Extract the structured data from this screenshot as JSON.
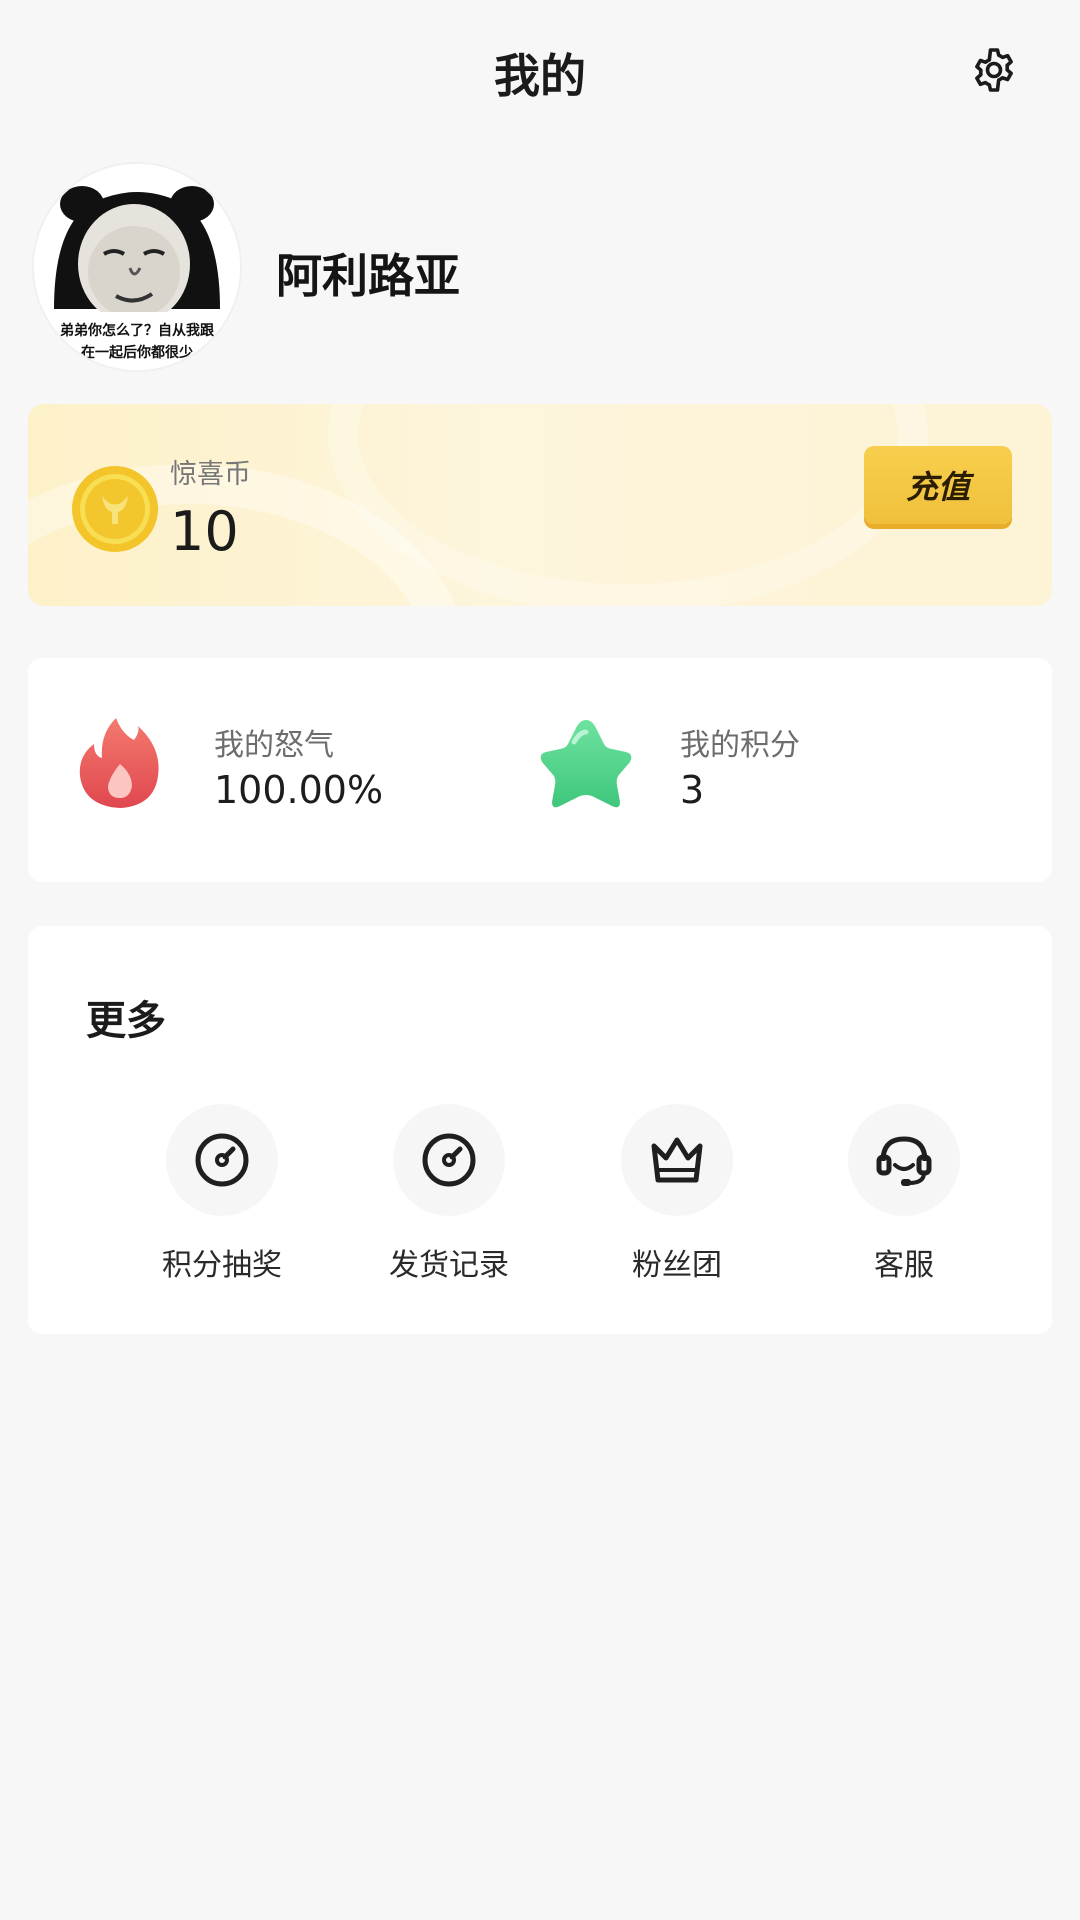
{
  "header": {
    "title": "我的"
  },
  "profile": {
    "username": "阿利路亚",
    "avatar_caption_1": "弟弟你怎么了？自从我跟",
    "avatar_caption_2": "在一起后你都很少"
  },
  "coin": {
    "label": "惊喜币",
    "value": "10",
    "recharge_label": "充值"
  },
  "stats": {
    "anger_label": "我的怒气",
    "anger_value": "100.00%",
    "points_label": "我的积分",
    "points_value": "3"
  },
  "more": {
    "title": "更多",
    "items": [
      {
        "label": "积分抽奖",
        "icon": "gauge-icon"
      },
      {
        "label": "发货记录",
        "icon": "gauge-icon"
      },
      {
        "label": "粉丝团",
        "icon": "crown-icon"
      },
      {
        "label": "客服",
        "icon": "headset-icon"
      }
    ]
  },
  "colors": {
    "background": "#f7f7f8",
    "coin_card": "#fdf1c9",
    "recharge_button": "#f5c842",
    "fire": "#ec5f67",
    "star": "#4fd58b"
  }
}
